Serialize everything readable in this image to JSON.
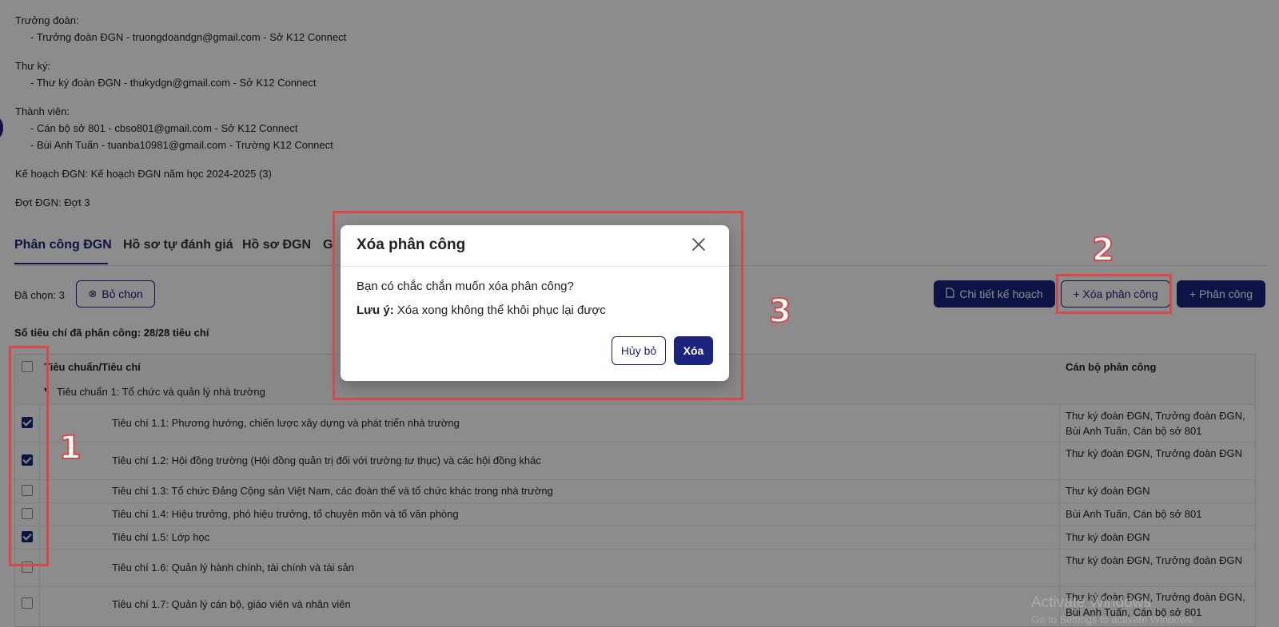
{
  "info": {
    "leader_label": "Trưởng đoàn:",
    "leader_line": "- Trưởng đoàn ĐGN - truongdoandgn@gmail.com - Sở K12 Connect",
    "secretary_label": "Thư ký:",
    "secretary_line": "- Thư ký đoàn ĐGN - thukydgn@gmail.com - Sở K12 Connect",
    "members_label": "Thành viên:",
    "member_1": "- Cán bộ sở 801 - cbso801@gmail.com - Sở K12 Connect",
    "member_2": "- Bùi Anh Tuấn - tuanba10981@gmail.com - Trường K12 Connect",
    "plan": "Kế hoạch ĐGN: Kế hoạch ĐGN năm học 2024-2025 (3)",
    "round": "Đợt ĐGN: Đợt 3"
  },
  "tabs": [
    "Phân công ĐGN",
    "Hồ sơ tự đánh giá",
    "Hồ sơ ĐGN",
    "G"
  ],
  "toolbar": {
    "selected": "Đã chọn: 3",
    "deselect": "Bỏ chọn",
    "plan_detail": "Chi tiết kế hoạch",
    "delete_assign": "+ Xóa phân công",
    "assign": "+ Phân công"
  },
  "summary": "Số tiêu chí đã phân công: 28/28 tiêu chí",
  "table": {
    "col_criteria": "Tiêu chuẩn/Tiêu chí",
    "col_staff": "Cán bộ phân công",
    "group": "Tiêu chuẩn 1: Tổ chức và quản lý nhà trường",
    "rows": [
      {
        "criteria": "Tiêu chí 1.1: Phương hướng, chiến lược xây dựng và phát triển nhà trường",
        "staff": "Thư ký đoàn ĐGN, Trưởng đoàn ĐGN, Bùi Anh Tuấn, Cán bộ sở 801",
        "checked": true
      },
      {
        "criteria": "Tiêu chí 1.2: Hội đồng trường (Hội đồng quản trị đối với trường tư thục) và các hội đồng khác",
        "staff": "Thư ký đoàn ĐGN, Trưởng đoàn ĐGN",
        "checked": true
      },
      {
        "criteria": "Tiêu chí 1.3: Tổ chức Đảng Cộng sản Việt Nam, các đoàn thể và tổ chức khác trong nhà trường",
        "staff": "Thư ký đoàn ĐGN",
        "checked": false
      },
      {
        "criteria": "Tiêu chí 1.4: Hiệu trưởng, phó hiệu trưởng, tổ chuyên môn và tổ văn phòng",
        "staff": "Bùi Anh Tuấn, Cán bộ sở 801",
        "checked": false
      },
      {
        "criteria": "Tiêu chí 1.5: Lớp học",
        "staff": "Thư ký đoàn ĐGN",
        "checked": true
      },
      {
        "criteria": "Tiêu chí 1.6: Quản lý hành chính, tài chính và tài sản",
        "staff": "Thư ký đoàn ĐGN, Trưởng đoàn ĐGN",
        "checked": false
      },
      {
        "criteria": "Tiêu chí 1.7: Quản lý cán bộ, giáo viên và nhân viên",
        "staff": "Thư ký đoàn ĐGN, Trưởng đoàn ĐGN, Bùi Anh Tuấn, Cán bộ sở 801",
        "checked": false
      }
    ]
  },
  "modal": {
    "title": "Xóa phân công",
    "message": "Bạn có chắc chắn muốn xóa phân công?",
    "note_label": "Lưu ý:",
    "note_text": " Xóa xong không thể khôi phục lại được",
    "cancel": "Hủy bỏ",
    "confirm": "Xóa"
  },
  "annotations": [
    "1",
    "2",
    "3"
  ],
  "watermark": "Activate Windows",
  "watermark_sub": "Go to Settings to activate Windows.",
  "colors": {
    "primary": "#1a237e",
    "annotation": "#d94848"
  }
}
